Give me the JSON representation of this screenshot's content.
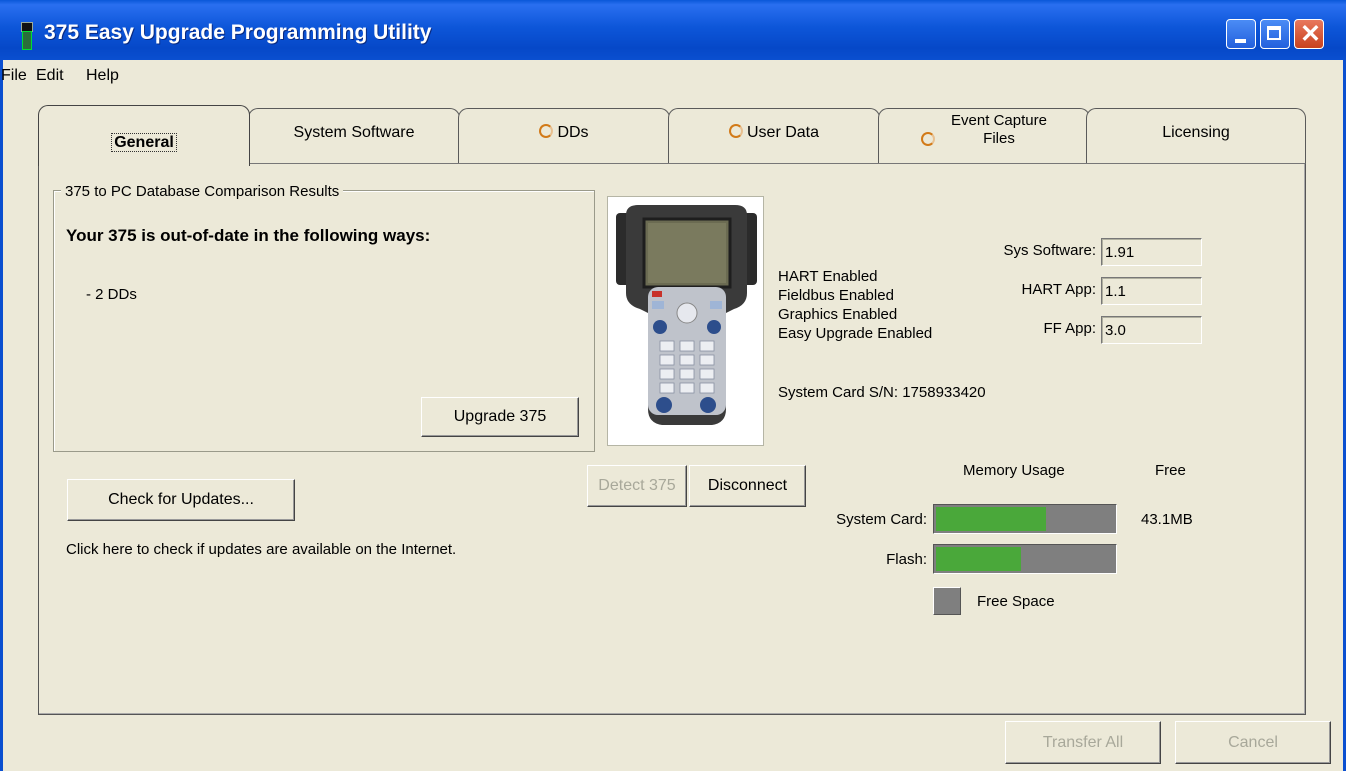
{
  "window": {
    "title": "375 Easy Upgrade Programming Utility",
    "icon": "handheld-app-icon"
  },
  "menu": [
    "File",
    "Edit",
    "Help"
  ],
  "tabs": [
    {
      "label": "General",
      "selected": true
    },
    {
      "label": "System Software"
    },
    {
      "label": "DDs",
      "status_icon": "pending-ring-icon"
    },
    {
      "label": "User Data",
      "status_icon": "pending-ring-icon"
    },
    {
      "label": "Event Capture Files",
      "line1": "Event Capture",
      "line2": "Files",
      "status_icon": "pending-ring-icon"
    },
    {
      "label": "Licensing"
    }
  ],
  "comparison": {
    "group_title": "375 to PC Database Comparison Results",
    "headline": "Your 375 is out-of-date in the following ways:",
    "items": [
      "- 2 DDs"
    ],
    "upgrade_button": "Upgrade 375"
  },
  "updates": {
    "button": "Check for Updates...",
    "hint": "Click here to check if updates are available on the Internet."
  },
  "connection": {
    "detect_button": "Detect 375",
    "disconnect_button": "Disconnect"
  },
  "device": {
    "features": [
      "HART Enabled",
      "Fieldbus Enabled",
      "Graphics Enabled",
      "Easy Upgrade Enabled"
    ],
    "serial": "System Card  S/N: 1758933420",
    "versions": [
      {
        "label": "Sys Software:",
        "value": "1.91"
      },
      {
        "label": "HART App:",
        "value": "1.1"
      },
      {
        "label": "FF App:",
        "value": "3.0"
      }
    ]
  },
  "memory": {
    "header": "Memory Usage",
    "free_header": "Free",
    "rows": [
      {
        "label": "System Card:",
        "used_fraction": 0.62,
        "free": "43.1MB"
      },
      {
        "label": "Flash:",
        "used_fraction": 0.48,
        "free": ""
      }
    ],
    "legend": "Free Space",
    "colors": {
      "used": "#4aa83a",
      "free": "#7f7f7f"
    }
  },
  "footer": {
    "transfer_button": "Transfer All",
    "cancel_button": "Cancel"
  }
}
